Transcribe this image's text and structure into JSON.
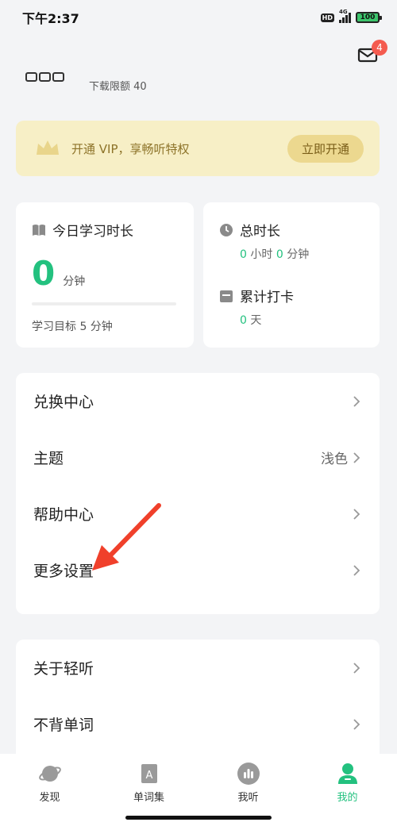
{
  "status_bar": {
    "time": "下午2:37",
    "hd": "HD",
    "network": "4G",
    "battery": "100"
  },
  "header": {
    "mail_badge_count": "4",
    "download_quota": "下载限额 40"
  },
  "vip_banner": {
    "text": "开通 VIP，享畅听特权",
    "button": "立即开通"
  },
  "today_card": {
    "title": "今日学习时长",
    "minutes": "0",
    "unit": "分钟",
    "progress_fraction": 0,
    "goal": "学习目标 5 分钟"
  },
  "stats_card": {
    "total_title": "总时长",
    "total_hours": "0",
    "hours_unit": "小时",
    "total_minutes": "0",
    "minutes_unit": "分钟",
    "checkin_title": "累计打卡",
    "checkin_days": "0",
    "days_unit": "天"
  },
  "menu": [
    {
      "label": "兑换中心",
      "value": ""
    },
    {
      "label": "主题",
      "value": "浅色"
    },
    {
      "label": "帮助中心",
      "value": ""
    },
    {
      "label": "更多设置",
      "value": ""
    }
  ],
  "menu2": [
    {
      "label": "关于轻听",
      "value": ""
    },
    {
      "label": "不背单词",
      "value": ""
    }
  ],
  "tabs": [
    {
      "label": "发现",
      "icon": "planet-icon"
    },
    {
      "label": "单词集",
      "icon": "word-book-icon"
    },
    {
      "label": "我听",
      "icon": "audio-bars-icon"
    },
    {
      "label": "我的",
      "icon": "profile-icon"
    }
  ],
  "colors": {
    "accent": "#23c17f",
    "vip_bg": "#f7efc6",
    "badge": "#f45b4f",
    "annotation_arrow": "#f0402b"
  }
}
